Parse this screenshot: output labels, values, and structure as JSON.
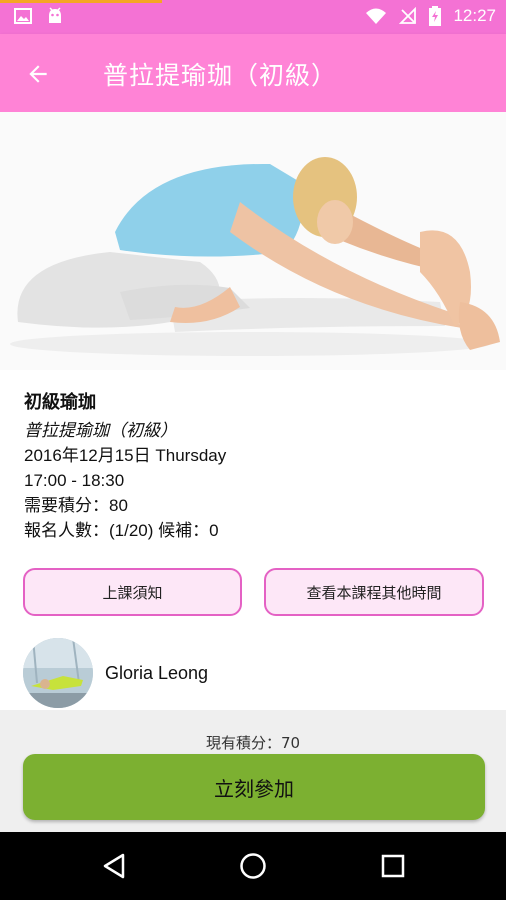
{
  "status_bar": {
    "time": "12:27",
    "icons": [
      "gallery-icon",
      "android-icon",
      "wifi-icon",
      "no-signal-icon",
      "battery-charging-icon"
    ]
  },
  "app_bar": {
    "title": "普拉提瑜珈（初級）",
    "back_icon": "arrow-back-icon"
  },
  "class_details": {
    "name": "初級瑜珈",
    "subtitle": "普拉提瑜珈（初級）",
    "date": "2016年12月15日 Thursday",
    "time": "17:00 - 18:30",
    "points_required": "需要積分：80",
    "enrollment": "報名人數：(1/20) 候補：0"
  },
  "buttons": {
    "notice": "上課須知",
    "other_times": "查看本課程其他時間",
    "join": "立刻參加"
  },
  "instructor": {
    "name": "Gloria Leong"
  },
  "footer": {
    "current_points": "現有積分：70"
  },
  "colors": {
    "status_bar": "#f472d4",
    "app_bar": "#ff83d6",
    "button_border": "#e461c4",
    "button_fill": "#fde7f7",
    "join_button": "#7cb031"
  },
  "nav_bar": {
    "icons": [
      "back-triangle-icon",
      "home-circle-icon",
      "recents-square-icon"
    ]
  }
}
